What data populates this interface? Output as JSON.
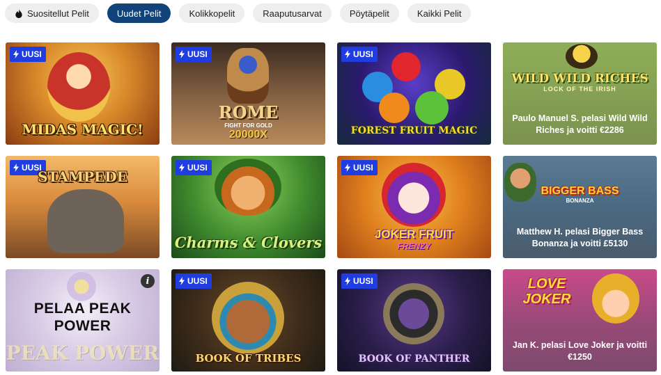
{
  "tabs": [
    {
      "label": "Suositellut Pelit",
      "icon": "flame-icon",
      "active": false
    },
    {
      "label": "Uudet Pelit",
      "active": true
    },
    {
      "label": "Kolikkopelit",
      "active": false
    },
    {
      "label": "Raaputusarvat",
      "active": false
    },
    {
      "label": "Pöytäpelit",
      "active": false
    },
    {
      "label": "Kaikki Pelit",
      "active": false
    }
  ],
  "badge_label": "UUSI",
  "cards": {
    "midas": {
      "logo": "MIDAS MAGIC!"
    },
    "rome": {
      "logo": "ROME",
      "subtitle": "FIGHT FOR GOLD",
      "multiplier": "20000X"
    },
    "forest": {
      "logo": "FOREST FRUIT MAGIC"
    },
    "wildwild": {
      "logo": "WILD WILD RICHES",
      "subtitle": "LOCK OF THE IRISH",
      "winner": "Paulo Manuel S. pelasi Wild Wild Riches ja voitti €2286"
    },
    "stampede": {
      "logo": "STAMPEDE"
    },
    "charms": {
      "logo": "Charms & Clovers"
    },
    "joker": {
      "logo": "JOKER FRUIT",
      "subtitle": "FRENZY"
    },
    "bigbass": {
      "logo": "BIGGER BASS",
      "subtitle": "BONANZA",
      "winner": "Matthew H. pelasi Bigger Bass Bonanza ja voitti £5130"
    },
    "peak": {
      "play_text": "PELAA PEAK POWER",
      "logo": "PEAK POWER"
    },
    "tribes": {
      "logo": "BOOK OF TRIBES"
    },
    "panther": {
      "logo": "BOOK OF PANTHER"
    },
    "lovejoker": {
      "logo": "LOVE JOKER",
      "winner": "Jan K. pelasi Love Joker ja voitti €1250"
    }
  },
  "colors": {
    "active_tab": "#12427a",
    "badge": "#1f3de0",
    "tab_bg": "#eeeeee"
  }
}
